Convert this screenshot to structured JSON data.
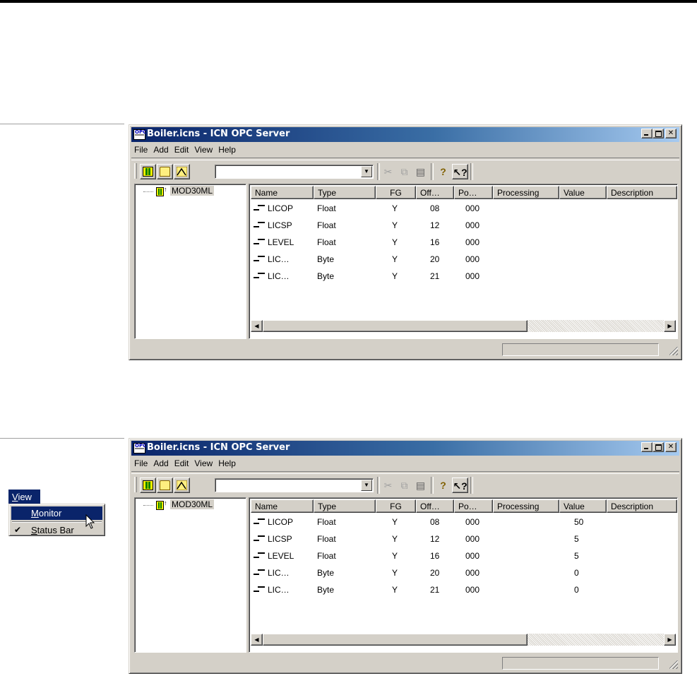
{
  "windows": [
    {
      "title": "Boiler.icns - ICN OPC Server",
      "menu": [
        "File",
        "Add",
        "Edit",
        "View",
        "Help"
      ],
      "tree_root": "MOD30ML",
      "columns": [
        "Name",
        "Type",
        "FG",
        "Off…",
        "Po…",
        "Processing",
        "Value",
        "Description"
      ],
      "rows": [
        {
          "name": "LICOP",
          "type": "Float",
          "fg": "Y",
          "off": "08",
          "po": "000",
          "processing": "",
          "value": ""
        },
        {
          "name": "LICSP",
          "type": "Float",
          "fg": "Y",
          "off": "12",
          "po": "000",
          "processing": "",
          "value": ""
        },
        {
          "name": "LEVEL",
          "type": "Float",
          "fg": "Y",
          "off": "16",
          "po": "000",
          "processing": "",
          "value": ""
        },
        {
          "name": "LIC…",
          "type": "Byte",
          "fg": "Y",
          "off": "20",
          "po": "000",
          "processing": "",
          "value": ""
        },
        {
          "name": "LIC…",
          "type": "Byte",
          "fg": "Y",
          "off": "21",
          "po": "000",
          "processing": "",
          "value": ""
        }
      ]
    },
    {
      "title": "Boiler.icns - ICN OPC Server",
      "menu": [
        "File",
        "Add",
        "Edit",
        "View",
        "Help"
      ],
      "tree_root": "MOD30ML",
      "columns": [
        "Name",
        "Type",
        "FG",
        "Off…",
        "Po…",
        "Processing",
        "Value",
        "Description"
      ],
      "rows": [
        {
          "name": "LICOP",
          "type": "Float",
          "fg": "Y",
          "off": "08",
          "po": "000",
          "processing": "",
          "value": "50"
        },
        {
          "name": "LICSP",
          "type": "Float",
          "fg": "Y",
          "off": "12",
          "po": "000",
          "processing": "",
          "value": "5"
        },
        {
          "name": "LEVEL",
          "type": "Float",
          "fg": "Y",
          "off": "16",
          "po": "000",
          "processing": "",
          "value": "5"
        },
        {
          "name": "LIC…",
          "type": "Byte",
          "fg": "Y",
          "off": "20",
          "po": "000",
          "processing": "",
          "value": "0"
        },
        {
          "name": "LIC…",
          "type": "Byte",
          "fg": "Y",
          "off": "21",
          "po": "000",
          "processing": "",
          "value": "0"
        }
      ]
    }
  ],
  "view_menu": {
    "label": "View",
    "items": [
      {
        "label": "Monitor",
        "selected": true,
        "checked": false
      },
      {
        "label": "Status Bar",
        "selected": false,
        "checked": true
      }
    ]
  },
  "toolbar_icons": [
    "monitor-icon",
    "open-folder-icon",
    "trend-icon",
    "cut-icon",
    "copy-icon",
    "paste-icon",
    "help-icon",
    "context-help-icon"
  ],
  "colors": {
    "title_active": "#0a246a",
    "face": "#d4d0c8",
    "menu_highlight": "#0a246a"
  }
}
